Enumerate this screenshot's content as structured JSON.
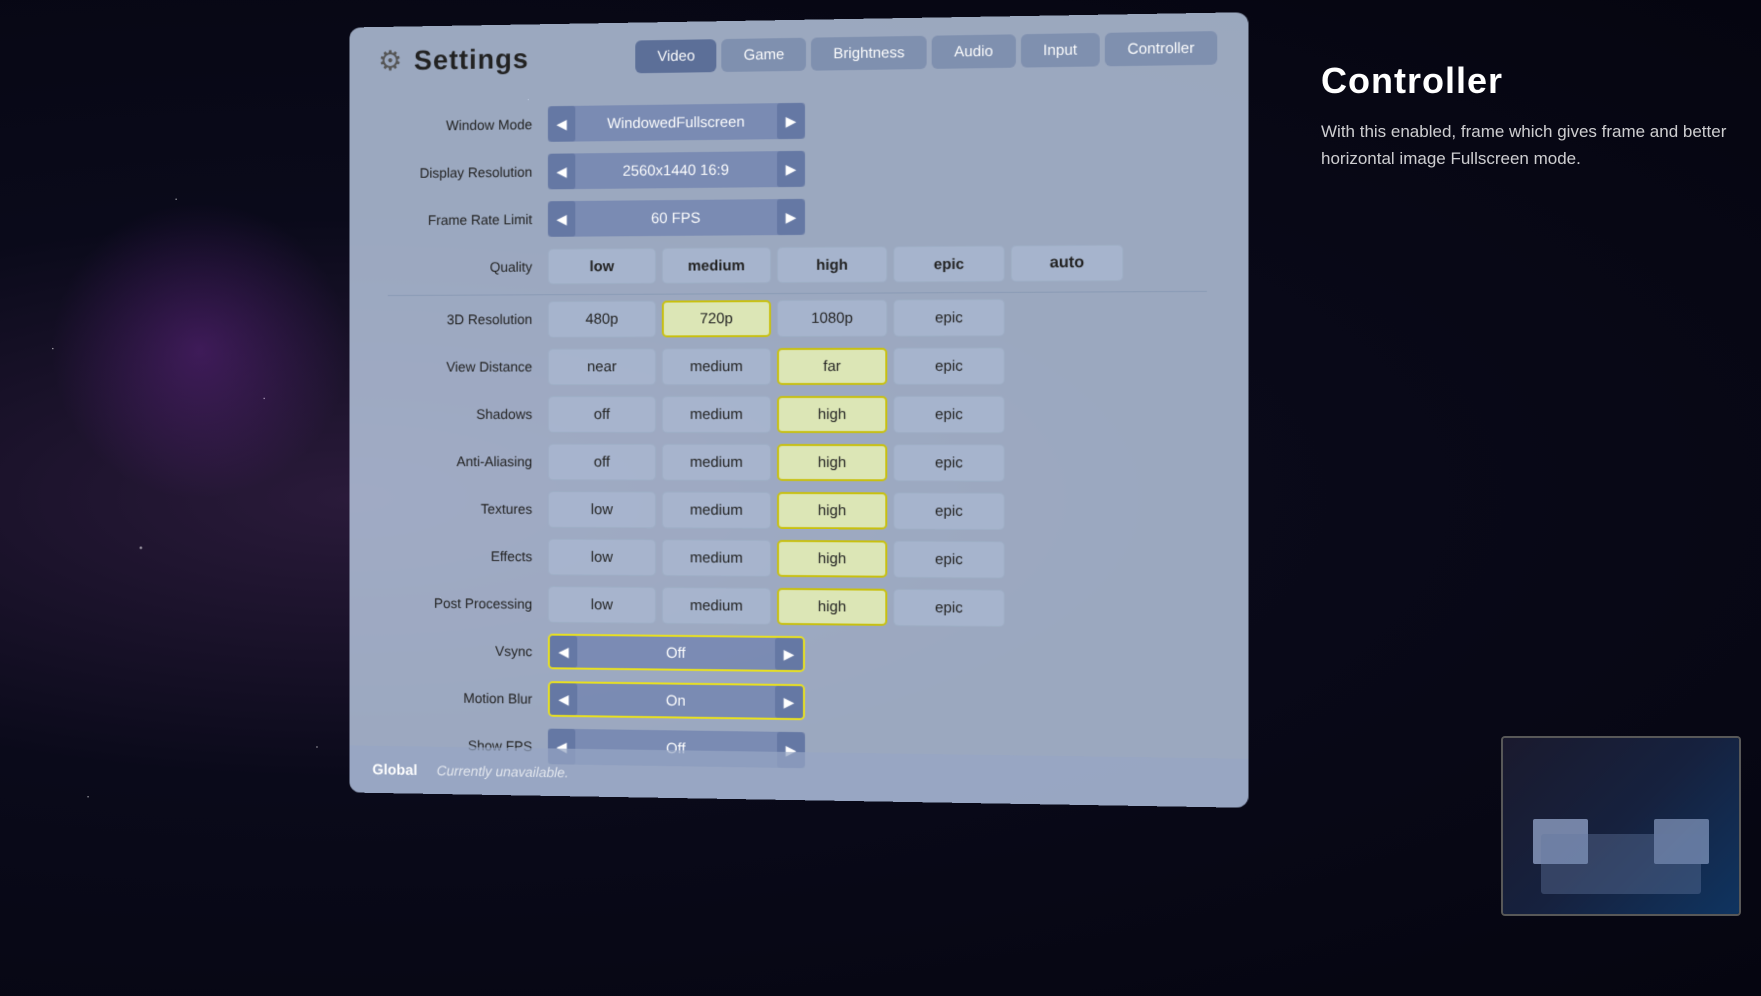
{
  "header": {
    "title": "Settings",
    "gear_symbol": "⚙"
  },
  "tabs": [
    {
      "id": "video",
      "label": "Video",
      "active": true
    },
    {
      "id": "game",
      "label": "Game",
      "active": false
    },
    {
      "id": "brightness",
      "label": "Brightness",
      "active": false
    },
    {
      "id": "audio",
      "label": "Audio",
      "active": false
    },
    {
      "id": "input",
      "label": "Input",
      "active": false
    },
    {
      "id": "controller",
      "label": "Controller",
      "active": false
    }
  ],
  "settings": {
    "window_mode": {
      "label": "Window Mode",
      "value": "WindowedFullscreen"
    },
    "display_resolution": {
      "label": "Display Resolution",
      "value": "2560x1440 16:9"
    },
    "frame_rate_limit": {
      "label": "Frame Rate Limit",
      "value": "60 FPS"
    },
    "quality": {
      "label": "Quality",
      "options": [
        "low",
        "medium",
        "high",
        "epic",
        "auto"
      ],
      "selected": null
    },
    "resolution_3d": {
      "label": "3D Resolution",
      "options": [
        "480p",
        "720p",
        "1080p",
        "epic"
      ],
      "selected": "720p"
    },
    "view_distance": {
      "label": "View Distance",
      "options": [
        "near",
        "medium",
        "far",
        "epic"
      ],
      "selected": "far"
    },
    "shadows": {
      "label": "Shadows",
      "options": [
        "off",
        "medium",
        "high",
        "epic"
      ],
      "selected": "high"
    },
    "anti_aliasing": {
      "label": "Anti-Aliasing",
      "options": [
        "off",
        "medium",
        "high",
        "epic"
      ],
      "selected": "high"
    },
    "textures": {
      "label": "Textures",
      "options": [
        "low",
        "medium",
        "high",
        "epic"
      ],
      "selected": "high"
    },
    "effects": {
      "label": "Effects",
      "options": [
        "low",
        "medium",
        "high",
        "epic"
      ],
      "selected": "high"
    },
    "post_processing": {
      "label": "Post Processing",
      "options": [
        "low",
        "medium",
        "high",
        "epic"
      ],
      "selected": "high"
    },
    "vsync": {
      "label": "Vsync",
      "value": "Off"
    },
    "motion_blur": {
      "label": "Motion Blur",
      "value": "On"
    },
    "show_fps": {
      "label": "Show FPS",
      "value": "Off"
    }
  },
  "bottom": {
    "global_label": "Global",
    "status_text": "Currently unavailable."
  },
  "right_panel": {
    "title": "Controller",
    "description": "With this enabled, frame which gives frame and better horizontal image Fullscreen mode."
  },
  "colors": {
    "selected_btn": "#e8e020",
    "panel_bg": "rgba(180, 195, 220, 0.85)",
    "tab_active": "rgba(80, 100, 145, 0.85)"
  }
}
